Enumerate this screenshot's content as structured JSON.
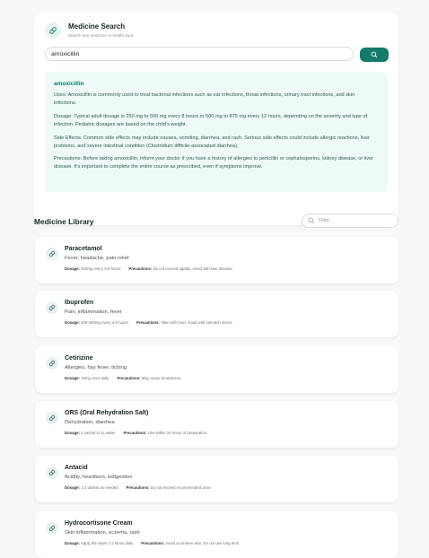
{
  "search": {
    "title": "Medicine Search",
    "subtitle": "Search any medicine or health topic",
    "value": "amoxicillin",
    "button_icon": "search-icon"
  },
  "result": {
    "name": "amoxicillin",
    "uses_label": "Uses:",
    "uses_text": "Amoxicillin is commonly used to treat bacterial infections such as ear infections, throat infections, urinary tract infections, and skin infections.",
    "dosage_label": "Dosage:",
    "dosage_text": "Typical adult dosage is 250 mg to 500 mg every 8 hours or 500 mg to 875 mg every 12 hours, depending on the severity and type of infection. Pediatric dosages are based on the child's weight.",
    "side_label": "Side Effects:",
    "side_text": "Common side effects may include nausea, vomiting, diarrhea, and rash. Serious side effects could include allergic reactions, liver problems, and severe intestinal condition (Clostridium difficile-associated diarrhea).",
    "prec_label": "Precautions:",
    "prec_text": "Before taking amoxicillin, inform your doctor if you have a history of allergies to penicillin or cephalosporins, kidney disease, or liver disease. It's important to complete the entire course as prescribed, even if symptoms improve."
  },
  "library": {
    "title": "Medicine Library",
    "filter_placeholder": "Filter...",
    "dosage_label": "Dosage:",
    "precautions_label": "Precautions:",
    "items": [
      {
        "name": "Paracetamol",
        "uses": "Fever, headache, pain relief",
        "dosage": "500mg every 4-6 hours",
        "precautions": "Do not exceed 4g/day. Avoid with liver disease."
      },
      {
        "name": "Ibuprofen",
        "uses": "Pain, inflammation, fever",
        "dosage": "200-400mg every 4-6 hours",
        "precautions": "Take with food. Avoid with stomach ulcers."
      },
      {
        "name": "Cetirizine",
        "uses": "Allergies, hay fever, itching",
        "dosage": "10mg once daily",
        "precautions": "May cause drowsiness."
      },
      {
        "name": "ORS (Oral Rehydration Salt)",
        "uses": "Dehydration, diarrhea",
        "dosage": "1 sachet in 1L water",
        "precautions": "Use within 24 hours of preparation."
      },
      {
        "name": "Antacid",
        "uses": "Acidity, heartburn, indigestion",
        "dosage": "1-2 tablets as needed",
        "precautions": "Do not exceed recommended dose."
      },
      {
        "name": "Hydrocortisone Cream",
        "uses": "Skin inflammation, eczema, rash",
        "dosage": "Apply thin layer 1-2 times daily",
        "precautions": "Avoid on broken skin. Do not use long term."
      }
    ]
  },
  "colors": {
    "accent": "#137a6c",
    "result_bg": "#eefaf7",
    "page_bg": "#f7f8f7"
  }
}
